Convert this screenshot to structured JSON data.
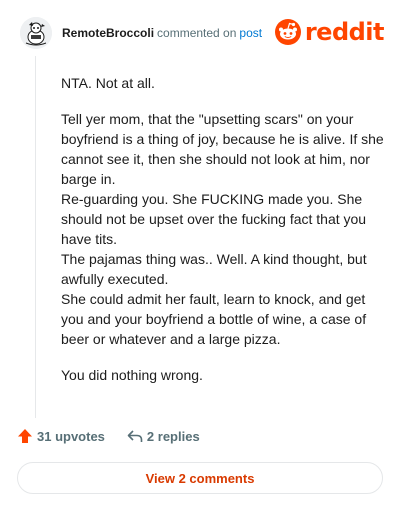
{
  "comment": {
    "username": "RemoteBroccoli",
    "commented_text": "commented on",
    "post_link": "post",
    "brand": "reddit",
    "paragraphs": [
      "NTA. Not at all.",
      "Tell yer mom, that the \"upsetting scars\" on your boyfriend is a thing of joy, because he is alive. If she cannot see it, then she should not look at him, nor barge in.",
      "Re-guarding you. She FUCKING made you. She should not be upset over the fucking fact that you have tits.",
      "The pajamas thing was.. Well. A kind thought, but awfully executed.",
      "She could admit her fault, learn to knock, and get you and your boyfriend a bottle of wine, a case of beer or whatever and a large pizza.",
      "You did nothing wrong."
    ]
  },
  "footer": {
    "upvotes_label": "31 upvotes",
    "replies_label": "2 replies",
    "view_comments_label": "View 2 comments"
  },
  "icons": {
    "avatar": "avatar-icon",
    "logo": "reddit-snoo-icon",
    "upvote": "upvote-arrow-icon",
    "reply": "reply-arrow-icon"
  },
  "colors": {
    "brand_orange": "#ff4500",
    "upvote": "#ff4500",
    "link_blue": "#0079d3",
    "meta_gray": "#576f76",
    "button_text": "#d93a00"
  }
}
